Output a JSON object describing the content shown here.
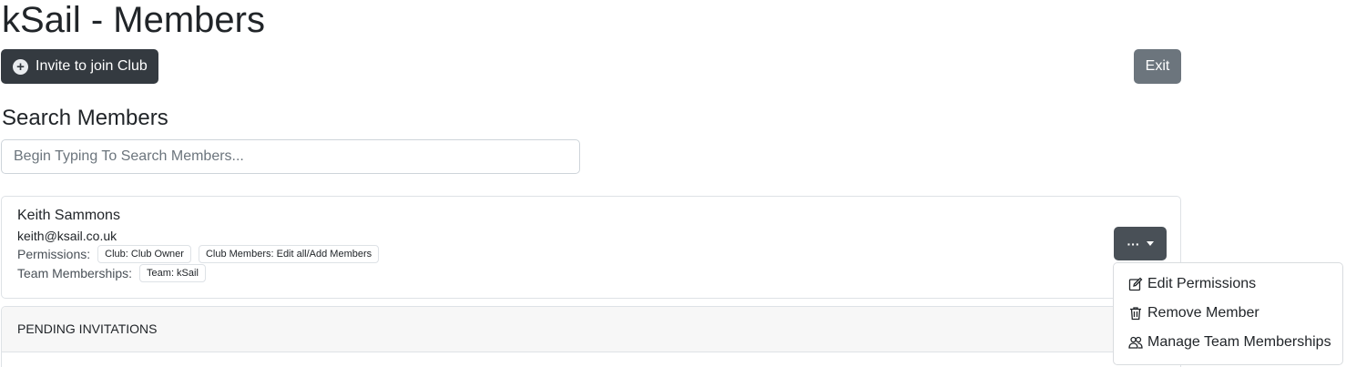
{
  "page": {
    "title": "kSail - Members"
  },
  "toolbar": {
    "invite_label": "Invite to join Club",
    "exit_label": "Exit"
  },
  "search": {
    "heading": "Search Members",
    "placeholder": "Begin Typing To Search Members...",
    "value": ""
  },
  "member": {
    "name": "Keith Sammons",
    "email": "keith@ksail.co.uk",
    "permissions_label": "Permissions:",
    "permissions": [
      "Club: Club Owner",
      "Club Members: Edit all/Add Members"
    ],
    "teams_label": "Team Memberships:",
    "teams": [
      "Team: kSail"
    ],
    "actions_label": "···"
  },
  "pending": {
    "header": "PENDING INVITATIONS"
  },
  "actions_menu": {
    "items": [
      {
        "label": "Edit Permissions",
        "icon": "pencil-square-icon"
      },
      {
        "label": "Remove Member",
        "icon": "trash-icon"
      },
      {
        "label": "Manage Team Memberships",
        "icon": "people-icon"
      }
    ]
  },
  "colors": {
    "dark_button": "#343a40",
    "secondary_button": "#6c757d",
    "actions_button": "#495057",
    "border": "#dee2e6",
    "pending_header_bg": "#f7f7f7"
  }
}
